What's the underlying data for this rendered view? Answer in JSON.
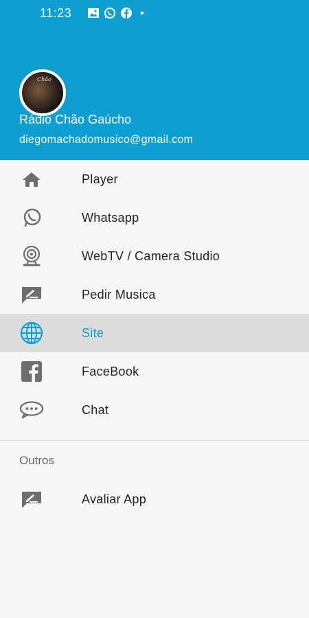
{
  "status_bar": {
    "time": "11:23"
  },
  "header": {
    "app_name": "Rádio Chão Gaúcho",
    "email": "diegomachadomusico@gmail.com",
    "avatar_text": "Chão"
  },
  "menu": {
    "items": [
      {
        "label": "Player",
        "icon": "home-icon"
      },
      {
        "label": "Whatsapp",
        "icon": "whatsapp-icon"
      },
      {
        "label": "WebTV / Camera Studio",
        "icon": "webcam-icon"
      },
      {
        "label": "Pedir Musica",
        "icon": "rate-edit-icon"
      },
      {
        "label": "Site",
        "icon": "globe-icon",
        "selected": true
      },
      {
        "label": "FaceBook",
        "icon": "facebook-icon"
      },
      {
        "label": "Chat",
        "icon": "chat-icon"
      }
    ],
    "section_title": "Outros",
    "other_items": [
      {
        "label": "Avaliar App",
        "icon": "rate-edit-icon"
      }
    ]
  },
  "colors": {
    "accent": "#0d9fd1",
    "icon_gray": "#6e6e6e",
    "selected_bg": "#dcdcdc"
  }
}
